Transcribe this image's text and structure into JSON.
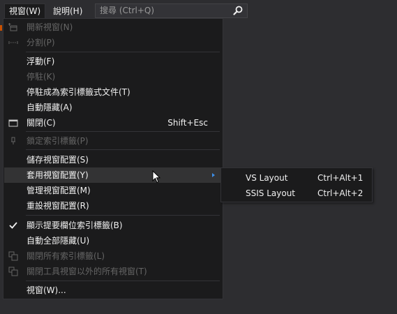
{
  "menubar": {
    "items": [
      {
        "label": "視窗(W)"
      },
      {
        "label": "說明(H)"
      }
    ],
    "search_placeholder": "搜尋 (Ctrl+Q)"
  },
  "window_menu": {
    "items": [
      {
        "label": "開新視窗(N)",
        "icon": "new-window-icon",
        "disabled": true
      },
      {
        "label": "分割(P)",
        "icon": "split-icon",
        "disabled": true
      },
      {
        "label": "浮動(F)"
      },
      {
        "label": "停駐(K)",
        "disabled": true
      },
      {
        "label": "停駐成為索引標籤式文件(T)"
      },
      {
        "label": "自動隱藏(A)"
      },
      {
        "label": "關閉(C)",
        "icon": "close-window-icon",
        "shortcut": "Shift+Esc"
      },
      {
        "label": "鎖定索引標籤(P)",
        "icon": "pin-icon",
        "disabled": true
      },
      {
        "label": "儲存視窗配置(S)"
      },
      {
        "label": "套用視窗配置(Y)",
        "highlighted": true,
        "has_submenu": true
      },
      {
        "label": "管理視窗配置(M)"
      },
      {
        "label": "重設視窗配置(R)"
      },
      {
        "label": "顯示提要欄位索引標籤(B)",
        "icon": "checkmark-icon",
        "checked": true
      },
      {
        "label": "自動全部隱藏(U)"
      },
      {
        "label": "關閉所有索引標籤(L)",
        "icon": "close-all-tabs-icon",
        "disabled": true
      },
      {
        "label": "關閉工具視窗以外的所有視窗(T)",
        "icon": "close-all-but-tools-icon",
        "disabled": true
      },
      {
        "label": "視窗(W)..."
      }
    ]
  },
  "layout_submenu": {
    "items": [
      {
        "label": "VS Layout",
        "shortcut": "Ctrl+Alt+1"
      },
      {
        "label": "SSIS Layout",
        "shortcut": "Ctrl+Alt+2"
      }
    ]
  },
  "colors": {
    "background": "#2d2d30",
    "menu_background": "#1b1b1c",
    "text": "#f1f1f1",
    "disabled_text": "#656565",
    "accent": "#ca5100",
    "submenu_arrow": "#3d8ee6"
  }
}
